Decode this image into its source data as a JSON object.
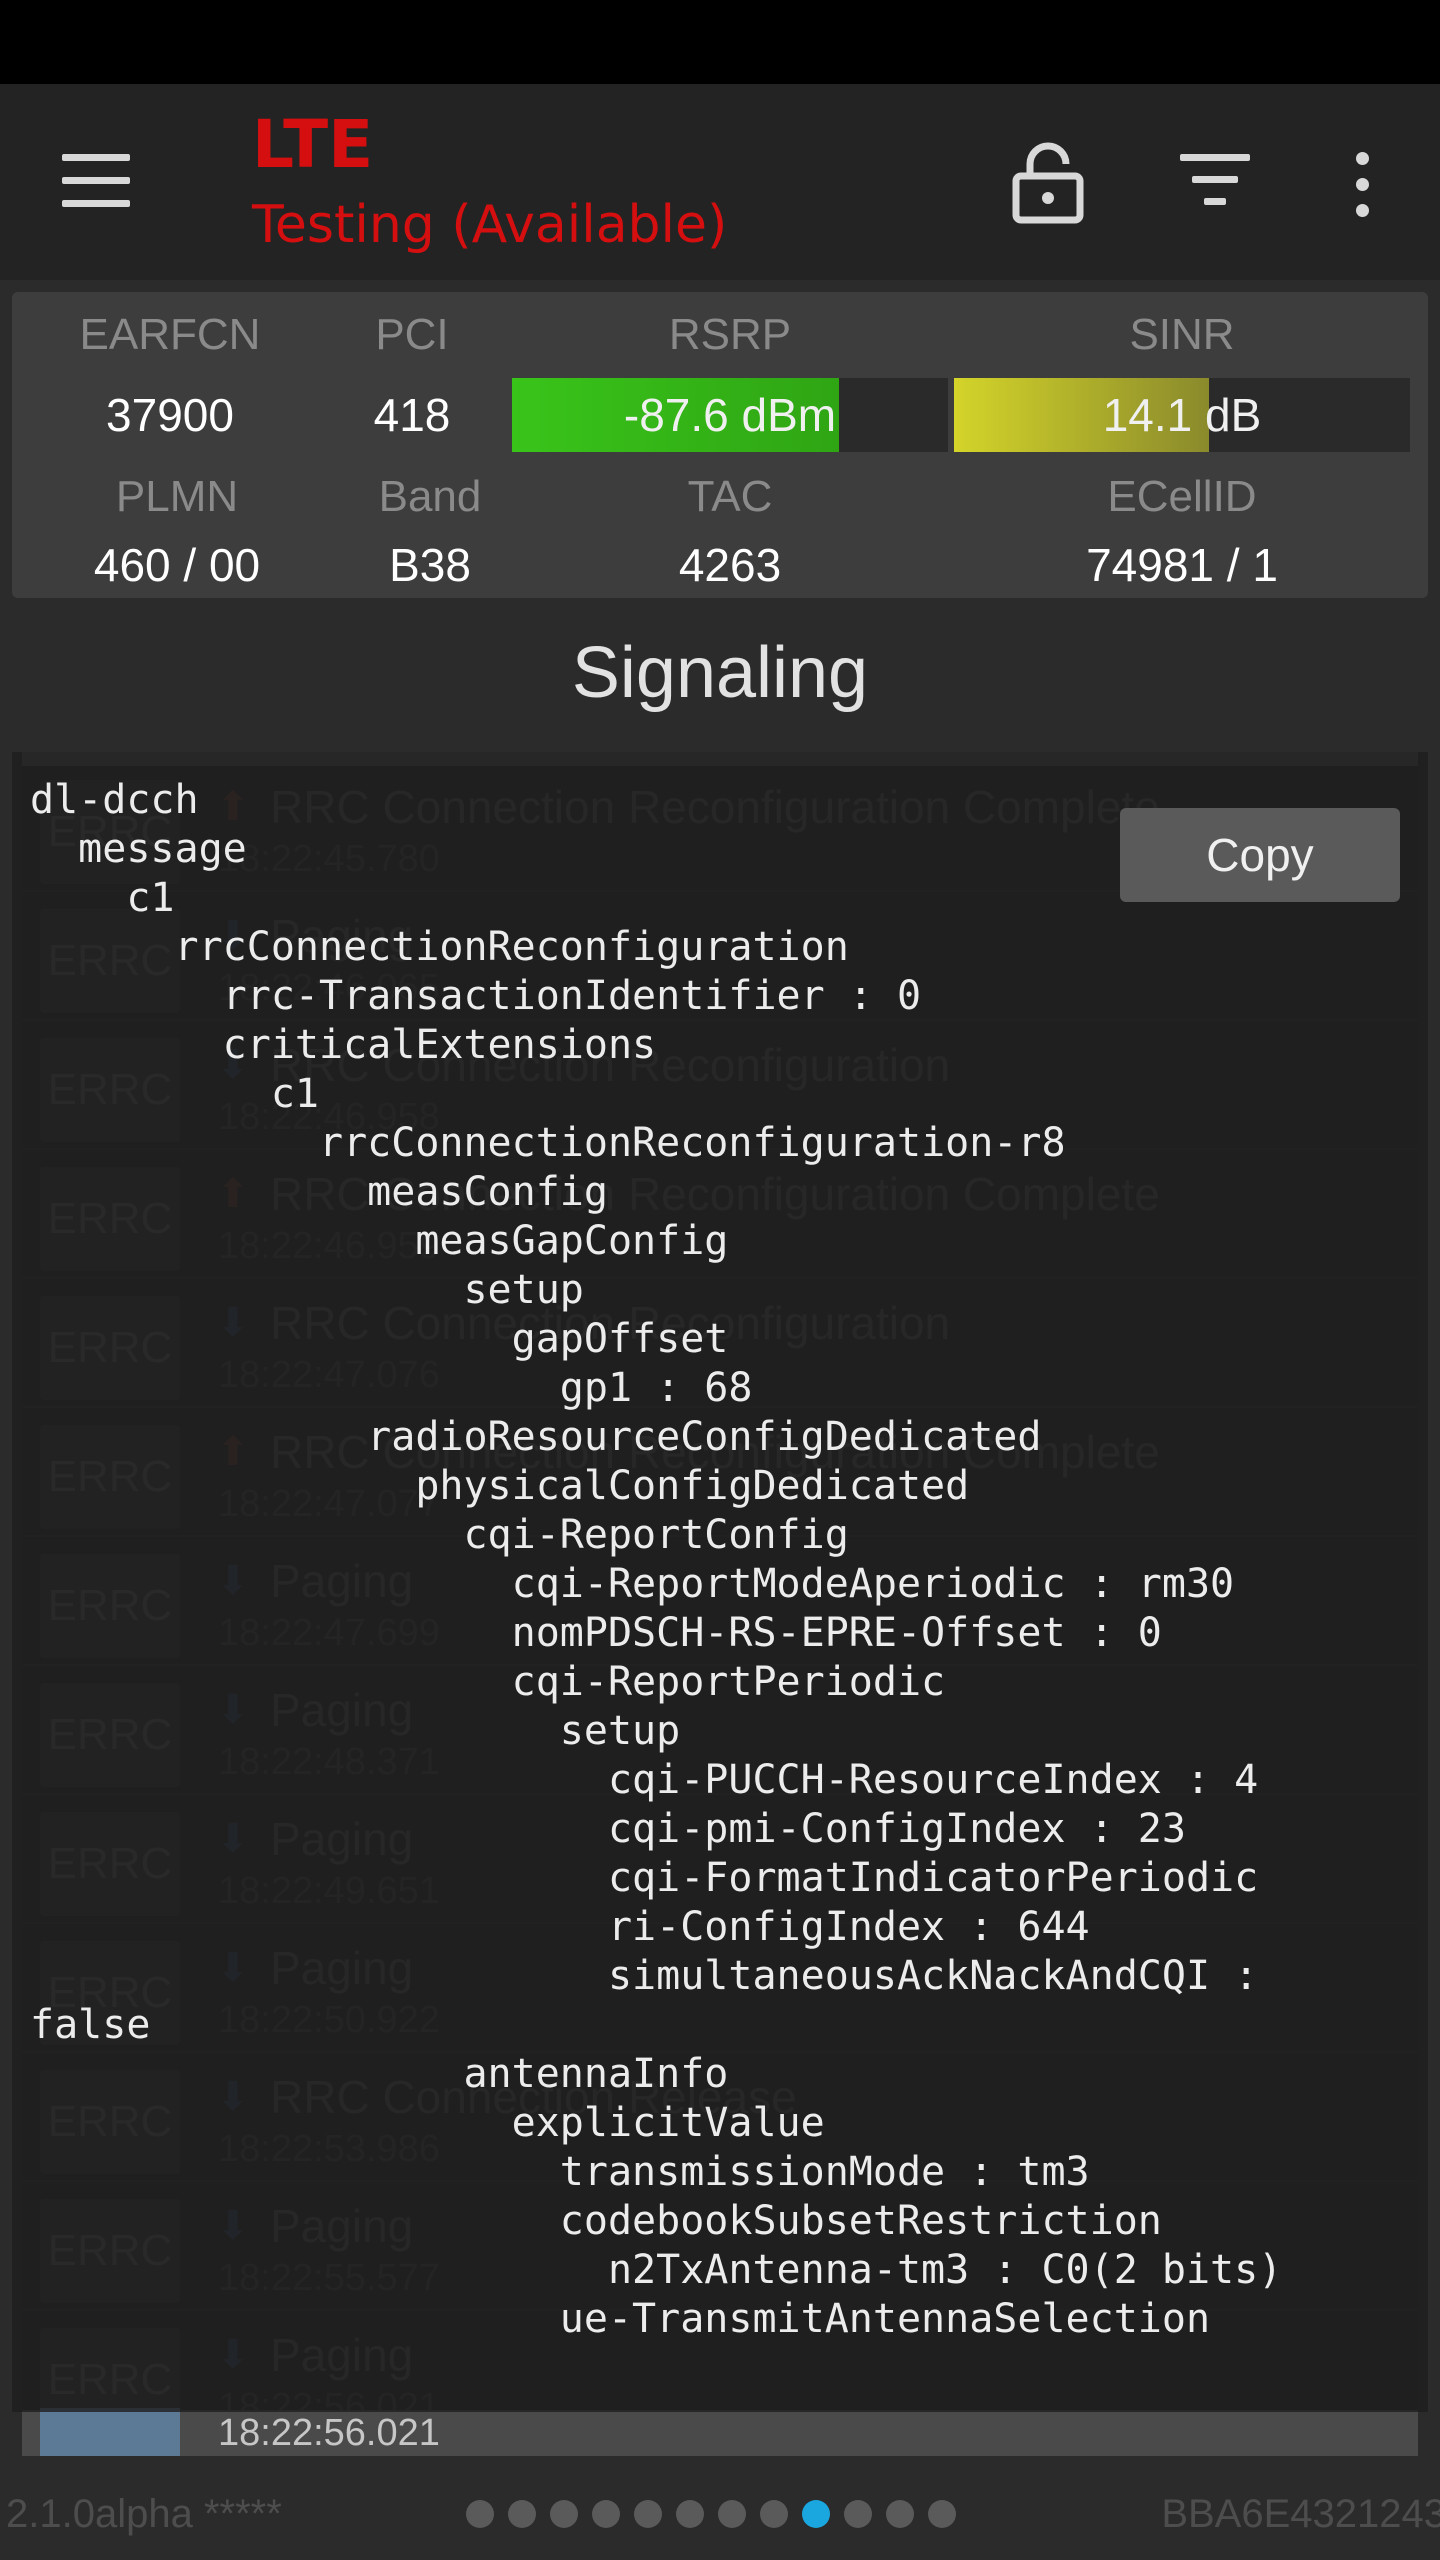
{
  "header": {
    "title": "LTE",
    "subtitle": "Testing (Available)",
    "icons": [
      "menu-icon",
      "lock-open-icon",
      "filter-icon",
      "more-vert-icon"
    ]
  },
  "cell_info": {
    "labels": {
      "earfcn": "EARFCN",
      "pci": "PCI",
      "rsrp": "RSRP",
      "sinr": "SINR",
      "plmn": "PLMN",
      "band": "Band",
      "tac": "TAC",
      "ecellid": "ECellID"
    },
    "earfcn": "37900",
    "pci": "418",
    "rsrp": {
      "text": "-87.6 dBm",
      "fill_fraction": 0.75,
      "color": "#39c41a"
    },
    "sinr": {
      "text": "14.1 dB",
      "fill_fraction": 0.56,
      "color": "#d4d42a"
    },
    "plmn": "460 / 00",
    "band": "B38",
    "tac": "4263",
    "ecellid": "74981 / 1"
  },
  "section_title": "Signaling",
  "messages": [
    {
      "layer": "ERRC",
      "direction": "up",
      "name": "RRC Connection Reconfiguration Complete",
      "time": "18:22:45.780"
    },
    {
      "layer": "ERRC",
      "direction": "down",
      "name": "Paging",
      "time": "18:22:46.065"
    },
    {
      "layer": "ERRC",
      "direction": "down",
      "name": "RRC Connection Reconfiguration",
      "time": "18:22:46.958"
    },
    {
      "layer": "ERRC",
      "direction": "up",
      "name": "RRC Connection Reconfiguration Complete",
      "time": "18:22:46.959"
    },
    {
      "layer": "ERRC",
      "direction": "down",
      "name": "RRC Connection Reconfiguration",
      "time": "18:22:47.076"
    },
    {
      "layer": "ERRC",
      "direction": "up",
      "name": "RRC Connection Reconfiguration Complete",
      "time": "18:22:47.077"
    },
    {
      "layer": "ERRC",
      "direction": "down",
      "name": "Paging",
      "time": "18:22:47.699"
    },
    {
      "layer": "ERRC",
      "direction": "down",
      "name": "Paging",
      "time": "18:22:48.371"
    },
    {
      "layer": "ERRC",
      "direction": "down",
      "name": "Paging",
      "time": "18:22:49.651"
    },
    {
      "layer": "ERRC",
      "direction": "down",
      "name": "Paging",
      "time": "18:22:50.922"
    },
    {
      "layer": "ERRC",
      "direction": "down",
      "name": "RRC Connection Release",
      "time": "18:22:53.986"
    },
    {
      "layer": "ERRC",
      "direction": "down",
      "name": "Paging",
      "time": "18:22:55.577"
    },
    {
      "layer": "ERRC",
      "direction": "down",
      "name": "Paging",
      "time": "18:22:56.021"
    }
  ],
  "list_top_time": "18:22:45.780",
  "list_bottom_time": "18:22:56.021",
  "detail": {
    "copy_label": "Copy",
    "text": "dl-dcch\n  message\n    c1\n      rrcConnectionReconfiguration\n        rrc-TransactionIdentifier : 0\n        criticalExtensions\n          c1\n            rrcConnectionReconfiguration-r8\n              measConfig\n                measGapConfig\n                  setup\n                    gapOffset\n                      gp1 : 68\n              radioResourceConfigDedicated\n                physicalConfigDedicated\n                  cqi-ReportConfig\n                    cqi-ReportModeAperiodic : rm30\n                    nomPDSCH-RS-EPRE-Offset : 0\n                    cqi-ReportPeriodic\n                      setup\n                        cqi-PUCCH-ResourceIndex : 4\n                        cqi-pmi-ConfigIndex : 23\n                        cqi-FormatIndicatorPeriodic\n                        ri-ConfigIndex : 644\n                        simultaneousAckNackAndCQI :\nfalse\n                  antennaInfo\n                    explicitValue\n                      transmissionMode : tm3\n                      codebookSubsetRestriction\n                        n2TxAntenna-tm3 : C0(2 bits)\n                      ue-TransmitAntennaSelection"
  },
  "footer": {
    "version": "2.1.0alpha *****",
    "device_id": "BBA6E4321243",
    "page_count": 12,
    "active_page": 9
  }
}
